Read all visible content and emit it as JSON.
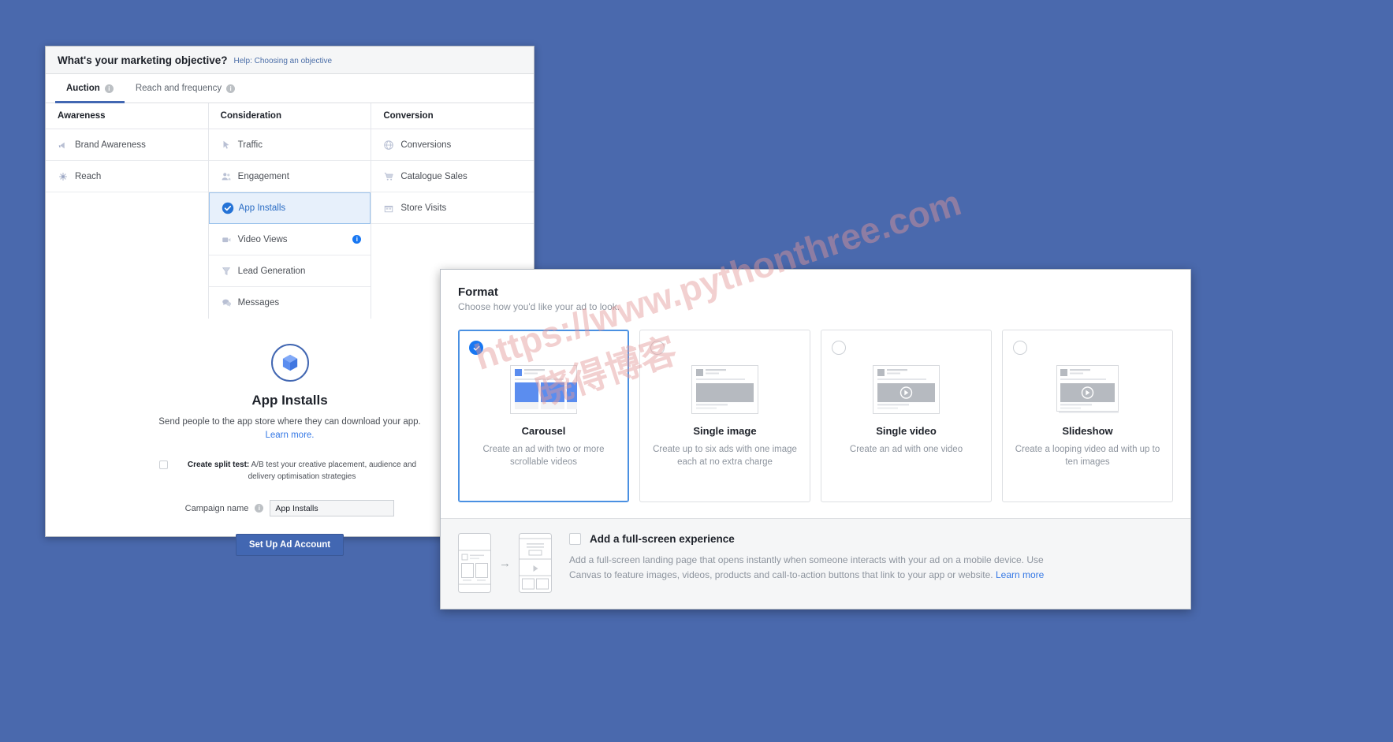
{
  "theme": {
    "background": "#4a69ad",
    "accent": "#4267b2",
    "link": "#3578e5",
    "selected_blue": "#1877f2"
  },
  "objective_panel": {
    "title": "What's your marketing objective?",
    "help_link": "Help: Choosing an objective",
    "tabs": [
      {
        "label": "Auction",
        "info": "i",
        "active": true
      },
      {
        "label": "Reach and frequency",
        "info": "i",
        "active": false
      }
    ],
    "columns": [
      {
        "header": "Awareness",
        "items": [
          {
            "label": "Brand Awareness",
            "icon": "megaphone-icon",
            "selected": false
          },
          {
            "label": "Reach",
            "icon": "reach-burst-icon",
            "selected": false
          }
        ]
      },
      {
        "header": "Consideration",
        "items": [
          {
            "label": "Traffic",
            "icon": "cursor-arrow-icon",
            "selected": false
          },
          {
            "label": "Engagement",
            "icon": "people-icon",
            "selected": false
          },
          {
            "label": "App Installs",
            "icon": "check-circle-icon",
            "selected": true
          },
          {
            "label": "Video Views",
            "icon": "video-camera-icon",
            "selected": false,
            "info": "i"
          },
          {
            "label": "Lead Generation",
            "icon": "funnel-icon",
            "selected": false
          },
          {
            "label": "Messages",
            "icon": "chat-bubbles-icon",
            "selected": false
          }
        ]
      },
      {
        "header": "Conversion",
        "items": [
          {
            "label": "Conversions",
            "icon": "globe-icon",
            "selected": false
          },
          {
            "label": "Catalogue Sales",
            "icon": "shopping-cart-icon",
            "selected": false
          },
          {
            "label": "Store Visits",
            "icon": "storefront-icon",
            "selected": false
          }
        ]
      }
    ],
    "detail": {
      "icon": "app-box-icon",
      "title": "App Installs",
      "description": "Send people to the app store where they can download your app.",
      "learn_more": "Learn more.",
      "split_test_label": "Create split test:",
      "split_test_description": "A/B test your creative placement, audience and delivery optimisation strategies",
      "campaign_name_label": "Campaign name",
      "campaign_name_info": "i",
      "campaign_name_value": "App Installs",
      "campaign_name_placeholder": "Campaign name",
      "cta_label": "Set Up Ad Account"
    }
  },
  "format_panel": {
    "title": "Format",
    "subtitle": "Choose how you'd like your ad to look.",
    "cards": [
      {
        "name": "Carousel",
        "description": "Create an ad with two or more scrollable videos",
        "selected": true,
        "thumb": "carousel-thumb"
      },
      {
        "name": "Single image",
        "description": "Create up to six ads with one image each at no extra charge",
        "selected": false,
        "thumb": "single-image-thumb"
      },
      {
        "name": "Single video",
        "description": "Create an ad with one video",
        "selected": false,
        "thumb": "single-video-thumb"
      },
      {
        "name": "Slideshow",
        "description": "Create a looping video ad with up to ten images",
        "selected": false,
        "thumb": "slideshow-thumb"
      }
    ],
    "fullscreen": {
      "checkbox_checked": false,
      "title": "Add a full-screen experience",
      "description": "Add a full-screen landing page that opens instantly when someone interacts with your ad on a mobile device. Use Canvas to feature images, videos, products and call-to-action buttons that link to your app or website.",
      "learn_more": "Learn more"
    }
  },
  "watermark": {
    "line1": "https://www.pythonthree.com",
    "line2": "晓得博客"
  }
}
